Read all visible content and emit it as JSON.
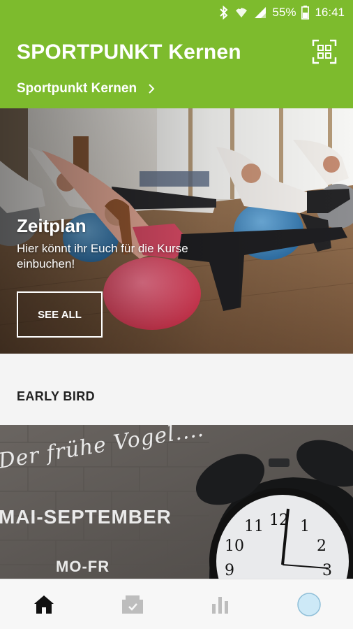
{
  "status_bar": {
    "battery": "55%",
    "time": "16:41"
  },
  "header": {
    "title": "SPORTPUNKT Kernen",
    "location": "Sportpunkt Kernen",
    "qr_icon": "qr-scan-icon"
  },
  "hero": {
    "title": "Zeitplan",
    "subtitle": "Hier könnt ihr Euch für die Kurse einbuchen!",
    "button_label": "SEE ALL"
  },
  "section": {
    "title": "EARLY BIRD"
  },
  "promo": {
    "script_line": "Der frühe Vogel....",
    "months": "MAI-SEPTEMBER",
    "days": "MO-FR"
  },
  "bottom_nav": {
    "items": [
      {
        "icon": "home-icon",
        "active": true
      },
      {
        "icon": "booking-icon",
        "active": false
      },
      {
        "icon": "stats-icon",
        "active": false
      },
      {
        "icon": "profile-icon",
        "active": false
      }
    ]
  },
  "colors": {
    "brand_green": "#7dbb2d",
    "nav_active": "#111111",
    "nav_inactive": "#bdbdbd",
    "avatar_blue": "#cde9f7"
  }
}
